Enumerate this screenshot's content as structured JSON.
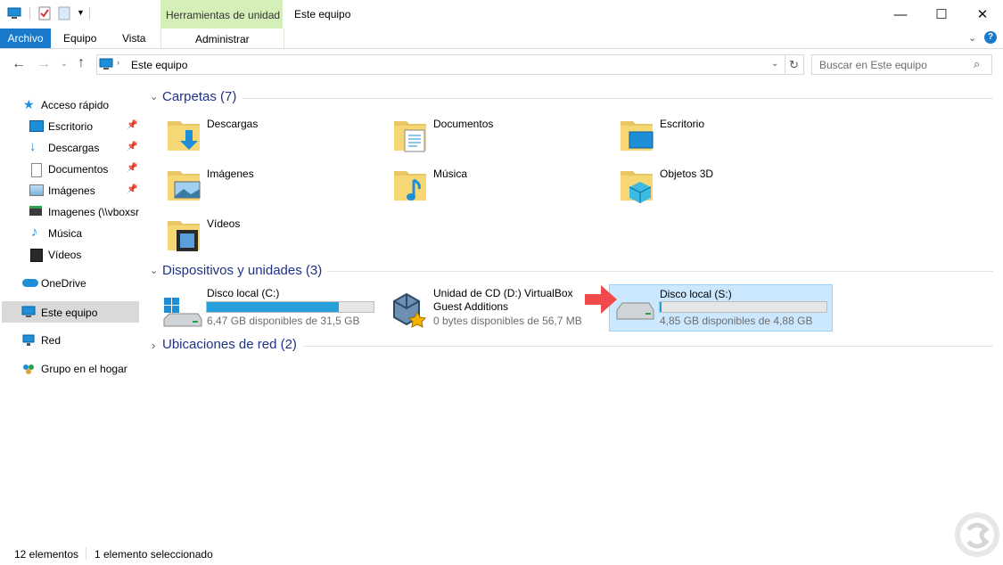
{
  "titlebar": {
    "tools_tab": "Herramientas de unidad",
    "title": "Este equipo",
    "minimize": "—",
    "maximize": "☐",
    "close": "✕"
  },
  "ribbon": {
    "tabs": {
      "archivo": "Archivo",
      "equipo": "Equipo",
      "vista": "Vista",
      "administrar": "Administrar"
    }
  },
  "addressbar": {
    "path": "Este equipo",
    "search_placeholder": "Buscar en Este equipo"
  },
  "nav": {
    "quick_access": "Acceso rápido",
    "escritorio": "Escritorio",
    "descargas": "Descargas",
    "documentos": "Documentos",
    "imagenes": "Imágenes",
    "imagenes_share": "Imagenes (\\\\vboxsr",
    "musica": "Música",
    "videos": "Vídeos",
    "onedrive": "OneDrive",
    "este_equipo": "Este equipo",
    "red": "Red",
    "grupo_hogar": "Grupo en el hogar"
  },
  "groups": {
    "carpetas": "Carpetas (7)",
    "dispositivos": "Dispositivos y unidades (3)",
    "red": "Ubicaciones de red (2)"
  },
  "folders": {
    "descargas": "Descargas",
    "documentos": "Documentos",
    "escritorio": "Escritorio",
    "imagenes": "Imágenes",
    "musica": "Música",
    "objetos3d": "Objetos 3D",
    "videos": "Vídeos"
  },
  "drives": {
    "c": {
      "name": "Disco local (C:)",
      "free": "6,47 GB disponibles de 31,5 GB",
      "used_fraction": 0.79
    },
    "d": {
      "name": "Unidad de CD (D:) VirtualBox Guest Additions",
      "free": "0 bytes disponibles de 56,7 MB"
    },
    "s": {
      "name": "Disco local (S:)",
      "free": "4,85 GB disponibles de 4,88 GB",
      "used_fraction": 0.006
    }
  },
  "status": {
    "count": "12 elementos",
    "selected": "1 elemento seleccionado"
  },
  "colors": {
    "accent": "#1979ca",
    "tools_tab": "#d4f0b8",
    "bar_fill": "#26a0da",
    "selection": "#cce8ff"
  }
}
